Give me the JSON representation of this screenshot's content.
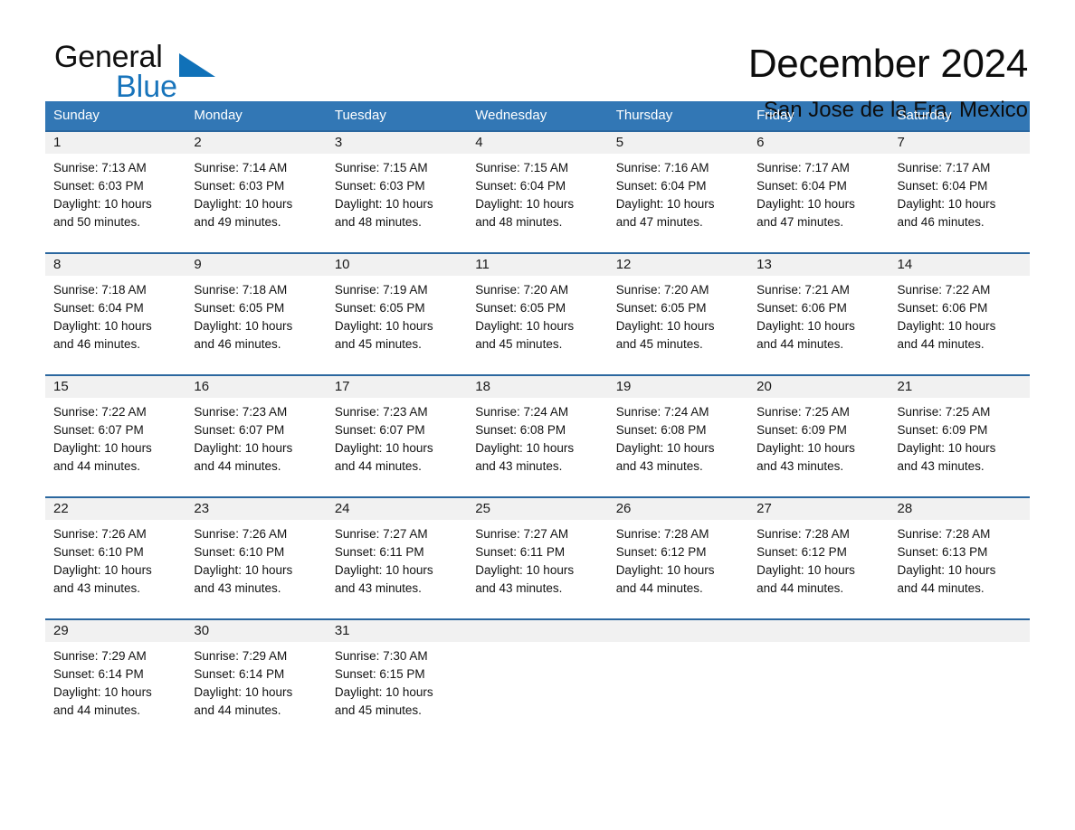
{
  "brand": {
    "name_part1": "General",
    "name_part2": "Blue",
    "triangle_color": "#1071b8"
  },
  "header": {
    "title": "December 2024",
    "subtitle": "San Jose de la Era, Mexico"
  },
  "colors": {
    "header_blue": "#3277b5",
    "row_border_blue": "#2b679f",
    "daynum_band": "#f1f1f1",
    "brand_blue": "#1874bb"
  },
  "weekdays": [
    "Sunday",
    "Monday",
    "Tuesday",
    "Wednesday",
    "Thursday",
    "Friday",
    "Saturday"
  ],
  "weeks": [
    [
      {
        "day": "1",
        "sunrise": "Sunrise: 7:13 AM",
        "sunset": "Sunset: 6:03 PM",
        "daylight1": "Daylight: 10 hours",
        "daylight2": "and 50 minutes."
      },
      {
        "day": "2",
        "sunrise": "Sunrise: 7:14 AM",
        "sunset": "Sunset: 6:03 PM",
        "daylight1": "Daylight: 10 hours",
        "daylight2": "and 49 minutes."
      },
      {
        "day": "3",
        "sunrise": "Sunrise: 7:15 AM",
        "sunset": "Sunset: 6:03 PM",
        "daylight1": "Daylight: 10 hours",
        "daylight2": "and 48 minutes."
      },
      {
        "day": "4",
        "sunrise": "Sunrise: 7:15 AM",
        "sunset": "Sunset: 6:04 PM",
        "daylight1": "Daylight: 10 hours",
        "daylight2": "and 48 minutes."
      },
      {
        "day": "5",
        "sunrise": "Sunrise: 7:16 AM",
        "sunset": "Sunset: 6:04 PM",
        "daylight1": "Daylight: 10 hours",
        "daylight2": "and 47 minutes."
      },
      {
        "day": "6",
        "sunrise": "Sunrise: 7:17 AM",
        "sunset": "Sunset: 6:04 PM",
        "daylight1": "Daylight: 10 hours",
        "daylight2": "and 47 minutes."
      },
      {
        "day": "7",
        "sunrise": "Sunrise: 7:17 AM",
        "sunset": "Sunset: 6:04 PM",
        "daylight1": "Daylight: 10 hours",
        "daylight2": "and 46 minutes."
      }
    ],
    [
      {
        "day": "8",
        "sunrise": "Sunrise: 7:18 AM",
        "sunset": "Sunset: 6:04 PM",
        "daylight1": "Daylight: 10 hours",
        "daylight2": "and 46 minutes."
      },
      {
        "day": "9",
        "sunrise": "Sunrise: 7:18 AM",
        "sunset": "Sunset: 6:05 PM",
        "daylight1": "Daylight: 10 hours",
        "daylight2": "and 46 minutes."
      },
      {
        "day": "10",
        "sunrise": "Sunrise: 7:19 AM",
        "sunset": "Sunset: 6:05 PM",
        "daylight1": "Daylight: 10 hours",
        "daylight2": "and 45 minutes."
      },
      {
        "day": "11",
        "sunrise": "Sunrise: 7:20 AM",
        "sunset": "Sunset: 6:05 PM",
        "daylight1": "Daylight: 10 hours",
        "daylight2": "and 45 minutes."
      },
      {
        "day": "12",
        "sunrise": "Sunrise: 7:20 AM",
        "sunset": "Sunset: 6:05 PM",
        "daylight1": "Daylight: 10 hours",
        "daylight2": "and 45 minutes."
      },
      {
        "day": "13",
        "sunrise": "Sunrise: 7:21 AM",
        "sunset": "Sunset: 6:06 PM",
        "daylight1": "Daylight: 10 hours",
        "daylight2": "and 44 minutes."
      },
      {
        "day": "14",
        "sunrise": "Sunrise: 7:22 AM",
        "sunset": "Sunset: 6:06 PM",
        "daylight1": "Daylight: 10 hours",
        "daylight2": "and 44 minutes."
      }
    ],
    [
      {
        "day": "15",
        "sunrise": "Sunrise: 7:22 AM",
        "sunset": "Sunset: 6:07 PM",
        "daylight1": "Daylight: 10 hours",
        "daylight2": "and 44 minutes."
      },
      {
        "day": "16",
        "sunrise": "Sunrise: 7:23 AM",
        "sunset": "Sunset: 6:07 PM",
        "daylight1": "Daylight: 10 hours",
        "daylight2": "and 44 minutes."
      },
      {
        "day": "17",
        "sunrise": "Sunrise: 7:23 AM",
        "sunset": "Sunset: 6:07 PM",
        "daylight1": "Daylight: 10 hours",
        "daylight2": "and 44 minutes."
      },
      {
        "day": "18",
        "sunrise": "Sunrise: 7:24 AM",
        "sunset": "Sunset: 6:08 PM",
        "daylight1": "Daylight: 10 hours",
        "daylight2": "and 43 minutes."
      },
      {
        "day": "19",
        "sunrise": "Sunrise: 7:24 AM",
        "sunset": "Sunset: 6:08 PM",
        "daylight1": "Daylight: 10 hours",
        "daylight2": "and 43 minutes."
      },
      {
        "day": "20",
        "sunrise": "Sunrise: 7:25 AM",
        "sunset": "Sunset: 6:09 PM",
        "daylight1": "Daylight: 10 hours",
        "daylight2": "and 43 minutes."
      },
      {
        "day": "21",
        "sunrise": "Sunrise: 7:25 AM",
        "sunset": "Sunset: 6:09 PM",
        "daylight1": "Daylight: 10 hours",
        "daylight2": "and 43 minutes."
      }
    ],
    [
      {
        "day": "22",
        "sunrise": "Sunrise: 7:26 AM",
        "sunset": "Sunset: 6:10 PM",
        "daylight1": "Daylight: 10 hours",
        "daylight2": "and 43 minutes."
      },
      {
        "day": "23",
        "sunrise": "Sunrise: 7:26 AM",
        "sunset": "Sunset: 6:10 PM",
        "daylight1": "Daylight: 10 hours",
        "daylight2": "and 43 minutes."
      },
      {
        "day": "24",
        "sunrise": "Sunrise: 7:27 AM",
        "sunset": "Sunset: 6:11 PM",
        "daylight1": "Daylight: 10 hours",
        "daylight2": "and 43 minutes."
      },
      {
        "day": "25",
        "sunrise": "Sunrise: 7:27 AM",
        "sunset": "Sunset: 6:11 PM",
        "daylight1": "Daylight: 10 hours",
        "daylight2": "and 43 minutes."
      },
      {
        "day": "26",
        "sunrise": "Sunrise: 7:28 AM",
        "sunset": "Sunset: 6:12 PM",
        "daylight1": "Daylight: 10 hours",
        "daylight2": "and 44 minutes."
      },
      {
        "day": "27",
        "sunrise": "Sunrise: 7:28 AM",
        "sunset": "Sunset: 6:12 PM",
        "daylight1": "Daylight: 10 hours",
        "daylight2": "and 44 minutes."
      },
      {
        "day": "28",
        "sunrise": "Sunrise: 7:28 AM",
        "sunset": "Sunset: 6:13 PM",
        "daylight1": "Daylight: 10 hours",
        "daylight2": "and 44 minutes."
      }
    ],
    [
      {
        "day": "29",
        "sunrise": "Sunrise: 7:29 AM",
        "sunset": "Sunset: 6:14 PM",
        "daylight1": "Daylight: 10 hours",
        "daylight2": "and 44 minutes."
      },
      {
        "day": "30",
        "sunrise": "Sunrise: 7:29 AM",
        "sunset": "Sunset: 6:14 PM",
        "daylight1": "Daylight: 10 hours",
        "daylight2": "and 44 minutes."
      },
      {
        "day": "31",
        "sunrise": "Sunrise: 7:30 AM",
        "sunset": "Sunset: 6:15 PM",
        "daylight1": "Daylight: 10 hours",
        "daylight2": "and 45 minutes."
      },
      {
        "day": "",
        "sunrise": "",
        "sunset": "",
        "daylight1": "",
        "daylight2": ""
      },
      {
        "day": "",
        "sunrise": "",
        "sunset": "",
        "daylight1": "",
        "daylight2": ""
      },
      {
        "day": "",
        "sunrise": "",
        "sunset": "",
        "daylight1": "",
        "daylight2": ""
      },
      {
        "day": "",
        "sunrise": "",
        "sunset": "",
        "daylight1": "",
        "daylight2": ""
      }
    ]
  ]
}
